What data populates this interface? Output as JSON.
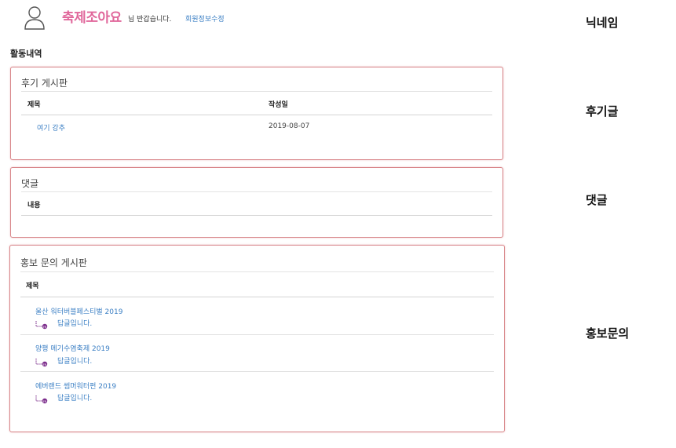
{
  "header": {
    "nickname": "축제조아요",
    "greeting": "님 반갑습니다.",
    "edit_profile_link": "회원정보수정"
  },
  "section_title": "활동내역",
  "side_labels": {
    "nickname": "닉네임",
    "reviews": "후기글",
    "comments": "댓글",
    "promo": "홍보문의"
  },
  "review_board": {
    "title": "후기 게시판",
    "col_title": "제목",
    "col_date": "작성일",
    "rows": [
      {
        "title": "여기 강추",
        "date": "2019-08-07"
      }
    ]
  },
  "comment_board": {
    "title": "댓글",
    "col_content": "내용"
  },
  "promo_board": {
    "title": "홍보 문의 게시판",
    "col_title": "제목",
    "rows": [
      {
        "title": "울산 워터버블페스티벌 2019",
        "reply": "답글입니다."
      },
      {
        "title": "양평 메기수염축제 2019",
        "reply": "답글입니다."
      },
      {
        "title": "에버랜드 썸머워터펀 2019",
        "reply": "답글입니다."
      }
    ]
  },
  "colors": {
    "nickname": "#e0679b",
    "link": "#3b7fc4",
    "box_border": "#d9878b",
    "reply_icon": "#7a2a8a"
  },
  "icons": {
    "avatar": "user-outline-icon",
    "reply": "reply-arrow-icon"
  }
}
